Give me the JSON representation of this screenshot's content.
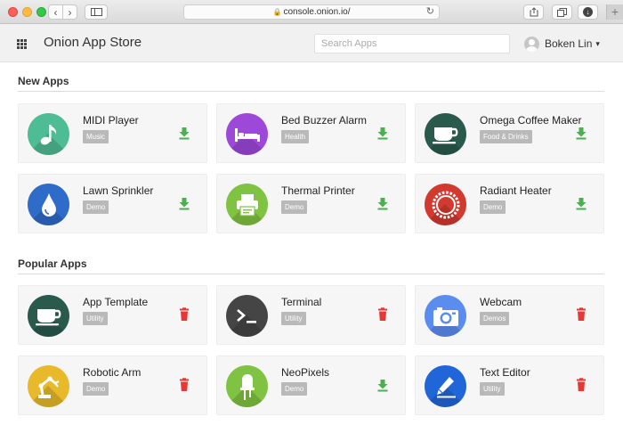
{
  "browser": {
    "url": "console.onion.io/"
  },
  "header": {
    "title": "Onion App Store",
    "search_placeholder": "Search Apps",
    "user_name": "Boken Lin"
  },
  "sections": {
    "new_apps": {
      "title": "New Apps",
      "apps": [
        {
          "name": "MIDI Player",
          "tag": "Music",
          "icon": "music-note-icon",
          "color": "#4ebc95",
          "action": "install"
        },
        {
          "name": "Bed Buzzer Alarm",
          "tag": "Health",
          "icon": "bed-icon",
          "color": "#9d48d9",
          "action": "install"
        },
        {
          "name": "Omega Coffee Maker",
          "tag": "Food & Drinks",
          "icon": "coffee-cup-icon",
          "color": "#2a5a4c",
          "action": "install"
        },
        {
          "name": "Lawn Sprinkler",
          "tag": "Demo",
          "icon": "water-drop-icon",
          "color": "#2f6bc9",
          "action": "install"
        },
        {
          "name": "Thermal Printer",
          "tag": "Demo",
          "icon": "printer-icon",
          "color": "#80c242",
          "action": "install"
        },
        {
          "name": "Radiant Heater",
          "tag": "Demo",
          "icon": "heater-icon",
          "color": "#d33a2f",
          "action": "install"
        }
      ]
    },
    "popular_apps": {
      "title": "Popular Apps",
      "apps": [
        {
          "name": "App Template",
          "tag": "Utility",
          "icon": "coffee-cup-icon",
          "color": "#2a5a4c",
          "action": "delete"
        },
        {
          "name": "Terminal",
          "tag": "Utility",
          "icon": "terminal-icon",
          "color": "#454545",
          "action": "delete"
        },
        {
          "name": "Webcam",
          "tag": "Demos",
          "icon": "camera-icon",
          "color": "#5b8df0",
          "action": "delete"
        },
        {
          "name": "Robotic Arm",
          "tag": "Demo",
          "icon": "robotic-arm-icon",
          "color": "#e7b92b",
          "action": "delete"
        },
        {
          "name": "NeoPixels",
          "tag": "Demo",
          "icon": "led-icon",
          "color": "#80c242",
          "action": "install"
        },
        {
          "name": "Text Editor",
          "tag": "Utility",
          "icon": "pen-icon",
          "color": "#2166d8",
          "action": "delete"
        }
      ]
    }
  },
  "colors": {
    "install_green": "#4caf50",
    "delete_red": "#e53935",
    "tag_gray": "#b9b9b9"
  }
}
